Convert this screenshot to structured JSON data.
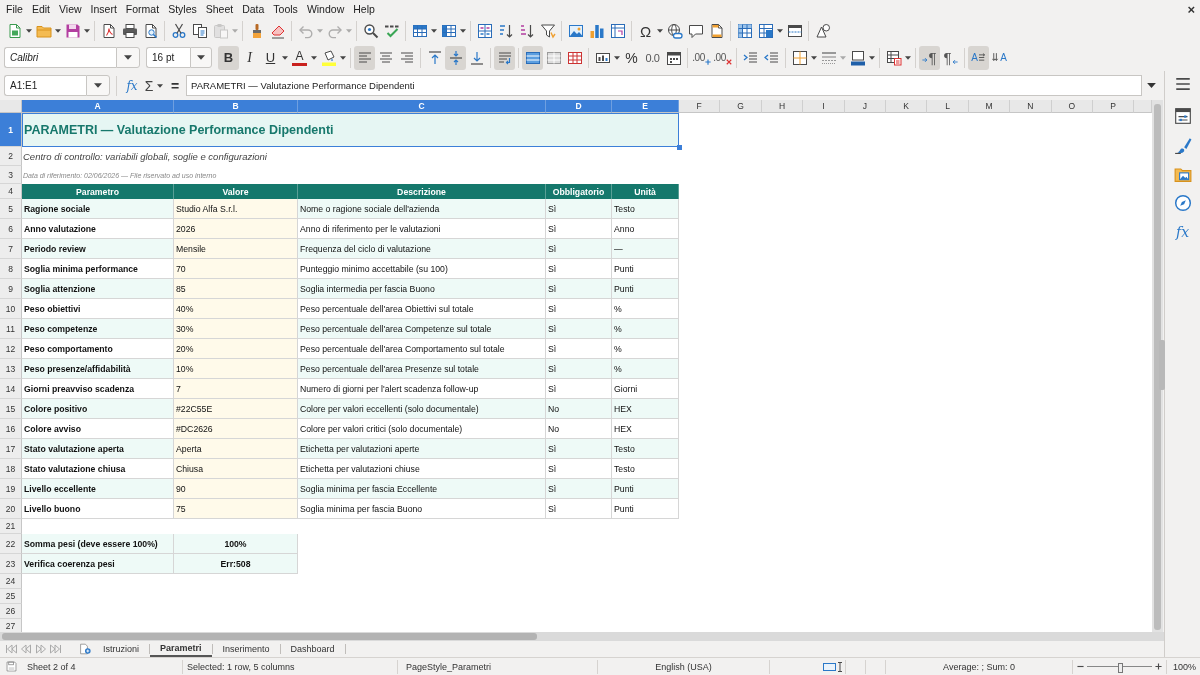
{
  "menu": [
    "File",
    "Edit",
    "View",
    "Insert",
    "Format",
    "Styles",
    "Sheet",
    "Data",
    "Tools",
    "Window",
    "Help"
  ],
  "close_document": "×",
  "standard_toolbar": {
    "special_character": "Ω",
    "disabled": {
      "paste": true,
      "undo": true,
      "redo": true
    }
  },
  "formatting_toolbar": {
    "font_name": "Calibri",
    "font_size": "16 pt",
    "style_buttons": [
      {
        "label": "B",
        "on": true
      },
      {
        "label": "I",
        "on": false
      },
      {
        "label": "U",
        "on": false
      }
    ],
    "font_color_label": "A",
    "horizontal_align": [
      {
        "kind": "left",
        "selected": true
      },
      {
        "kind": "center",
        "selected": false
      },
      {
        "kind": "right",
        "selected": false
      }
    ],
    "vertical_align": [
      {
        "kind": "top",
        "selected": false
      },
      {
        "kind": "middle",
        "selected": true
      },
      {
        "kind": "bottom",
        "selected": false
      }
    ],
    "wrap_text": true,
    "merge_buttons": [
      {
        "kind": "merge-center",
        "on": true
      },
      {
        "kind": "merge",
        "on": false
      },
      {
        "kind": "unmerge",
        "on": false
      }
    ],
    "percent_symbol": "%",
    "standard_symbol": "0.0",
    "add_decimal": ".00",
    "delete_decimal": ".00",
    "paragraph_direction": [
      {
        "kind": "ltr",
        "symbol": "¶",
        "selected": true
      },
      {
        "kind": "rtl",
        "symbol": "¶",
        "selected": false
      }
    ],
    "text_direction": [
      {
        "kind": "horizontal",
        "symbol": "A",
        "selected": true
      },
      {
        "kind": "vertical",
        "symbol": "A",
        "selected": false
      }
    ]
  },
  "formula_bar": {
    "name_box": "A1:E1",
    "function_wizard": "fx",
    "sum": "Σ",
    "equals": "=",
    "content": "PARAMETRI — Valutazione Performance Dipendenti"
  },
  "sheet": {
    "columns": [
      {
        "label": "A",
        "selected": true
      },
      {
        "label": "B",
        "selected": true
      },
      {
        "label": "C",
        "selected": true
      },
      {
        "label": "D",
        "selected": true
      },
      {
        "label": "E",
        "selected": true
      },
      {
        "label": "F",
        "selected": false
      },
      {
        "label": "G",
        "selected": false
      },
      {
        "label": "H",
        "selected": false
      },
      {
        "label": "I",
        "selected": false
      },
      {
        "label": "J",
        "selected": false
      },
      {
        "label": "K",
        "selected": false
      },
      {
        "label": "L",
        "selected": false
      },
      {
        "label": "M",
        "selected": false
      },
      {
        "label": "N",
        "selected": false
      },
      {
        "label": "O",
        "selected": false
      },
      {
        "label": "P",
        "selected": false
      }
    ],
    "rows": [
      {
        "number": "1",
        "selected": true,
        "kind": "title",
        "text": "PARAMETRI — Valutazione Performance Dipendenti"
      },
      {
        "number": "2",
        "selected": false,
        "kind": "subtitle",
        "text": "Centro di controllo: variabili globali, soglie e configurazioni"
      },
      {
        "number": "3",
        "selected": false,
        "kind": "note",
        "text": "Data di riferimento: 02/06/2026 — File riservato ad uso interno"
      },
      {
        "number": "4",
        "selected": false,
        "kind": "header",
        "cells": [
          "Parametro",
          "Valore",
          "Descrizione",
          "Obbligatorio",
          "Unità"
        ]
      },
      {
        "number": "5",
        "selected": false,
        "kind": "data",
        "cells": [
          "Ragione sociale",
          "Studio Alfa S.r.l.",
          "Nome o ragione sociale dell'azienda",
          "Sì",
          "Testo"
        ]
      },
      {
        "number": "6",
        "selected": false,
        "kind": "data",
        "cells": [
          "Anno valutazione",
          "2026",
          "Anno di riferimento per le valutazioni",
          "Sì",
          "Anno"
        ]
      },
      {
        "number": "7",
        "selected": false,
        "kind": "data",
        "cells": [
          "Periodo review",
          "Mensile",
          "Frequenza del ciclo di valutazione",
          "Sì",
          "—"
        ]
      },
      {
        "number": "8",
        "selected": false,
        "kind": "data",
        "cells": [
          "Soglia minima performance",
          "70",
          "Punteggio minimo accettabile (su 100)",
          "Sì",
          "Punti"
        ]
      },
      {
        "number": "9",
        "selected": false,
        "kind": "data",
        "cells": [
          "Soglia attenzione",
          "85",
          "Soglia intermedia per fascia Buono",
          "Sì",
          "Punti"
        ]
      },
      {
        "number": "10",
        "selected": false,
        "kind": "data",
        "cells": [
          "Peso obiettivi",
          "40%",
          "Peso percentuale dell'area Obiettivi sul totale",
          "Sì",
          "%"
        ]
      },
      {
        "number": "11",
        "selected": false,
        "kind": "data",
        "cells": [
          "Peso competenze",
          "30%",
          "Peso percentuale dell'area Competenze sul totale",
          "Sì",
          "%"
        ]
      },
      {
        "number": "12",
        "selected": false,
        "kind": "data",
        "cells": [
          "Peso comportamento",
          "20%",
          "Peso percentuale dell'area Comportamento sul totale",
          "Sì",
          "%"
        ]
      },
      {
        "number": "13",
        "selected": false,
        "kind": "data",
        "cells": [
          "Peso presenze/affidabilità",
          "10%",
          "Peso percentuale dell'area Presenze sul totale",
          "Sì",
          "%"
        ]
      },
      {
        "number": "14",
        "selected": false,
        "kind": "data",
        "cells": [
          "Giorni preavviso scadenza",
          "7",
          "Numero di giorni per l'alert scadenza follow-up",
          "Sì",
          "Giorni"
        ]
      },
      {
        "number": "15",
        "selected": false,
        "kind": "data",
        "cells": [
          "Colore positivo",
          "#22C55E",
          "Colore per valori eccellenti (solo documentale)",
          "No",
          "HEX"
        ]
      },
      {
        "number": "16",
        "selected": false,
        "kind": "data",
        "cells": [
          "Colore avviso",
          "#DC2626",
          "Colore per valori critici (solo documentale)",
          "No",
          "HEX"
        ]
      },
      {
        "number": "17",
        "selected": false,
        "kind": "data",
        "cells": [
          "Stato valutazione aperta",
          "Aperta",
          "Etichetta per valutazioni aperte",
          "Sì",
          "Testo"
        ]
      },
      {
        "number": "18",
        "selected": false,
        "kind": "data",
        "cells": [
          "Stato valutazione chiusa",
          "Chiusa",
          "Etichetta per valutazioni chiuse",
          "Sì",
          "Testo"
        ]
      },
      {
        "number": "19",
        "selected": false,
        "kind": "data",
        "cells": [
          "Livello eccellente",
          "90",
          "Soglia minima per fascia Eccellente",
          "Sì",
          "Punti"
        ]
      },
      {
        "number": "20",
        "selected": false,
        "kind": "data",
        "cells": [
          "Livello buono",
          "75",
          "Soglia minima per fascia Buono",
          "Sì",
          "Punti"
        ]
      },
      {
        "number": "21",
        "selected": false,
        "kind": "blank"
      },
      {
        "number": "22",
        "selected": false,
        "kind": "summary",
        "cells": [
          "Somma pesi (deve essere 100%)",
          "100%"
        ]
      },
      {
        "number": "23",
        "selected": false,
        "kind": "summary",
        "cells": [
          "Verifica coerenza pesi",
          "Err:508"
        ]
      },
      {
        "number": "24",
        "selected": false,
        "kind": "blank"
      },
      {
        "number": "25",
        "selected": false,
        "kind": "blank"
      },
      {
        "number": "26",
        "selected": false,
        "kind": "blank"
      },
      {
        "number": "27",
        "selected": false,
        "kind": "blank"
      }
    ]
  },
  "sheet_tabs": [
    {
      "label": "Istruzioni",
      "selected": false
    },
    {
      "label": "Parametri",
      "selected": true
    },
    {
      "label": "Inserimento",
      "selected": false
    },
    {
      "label": "Dashboard",
      "selected": false
    }
  ],
  "sidebar": {
    "functions": "fx"
  },
  "status_bar": {
    "sheet_position": "Sheet 2 of 4",
    "selection": "Selected: 1 row, 5 columns",
    "page_style": "PageStyle_Parametri",
    "language": "English (USA)",
    "sum": "Average: ; Sum: 0",
    "zoom": {
      "level": 0.5,
      "label": "100%"
    }
  }
}
